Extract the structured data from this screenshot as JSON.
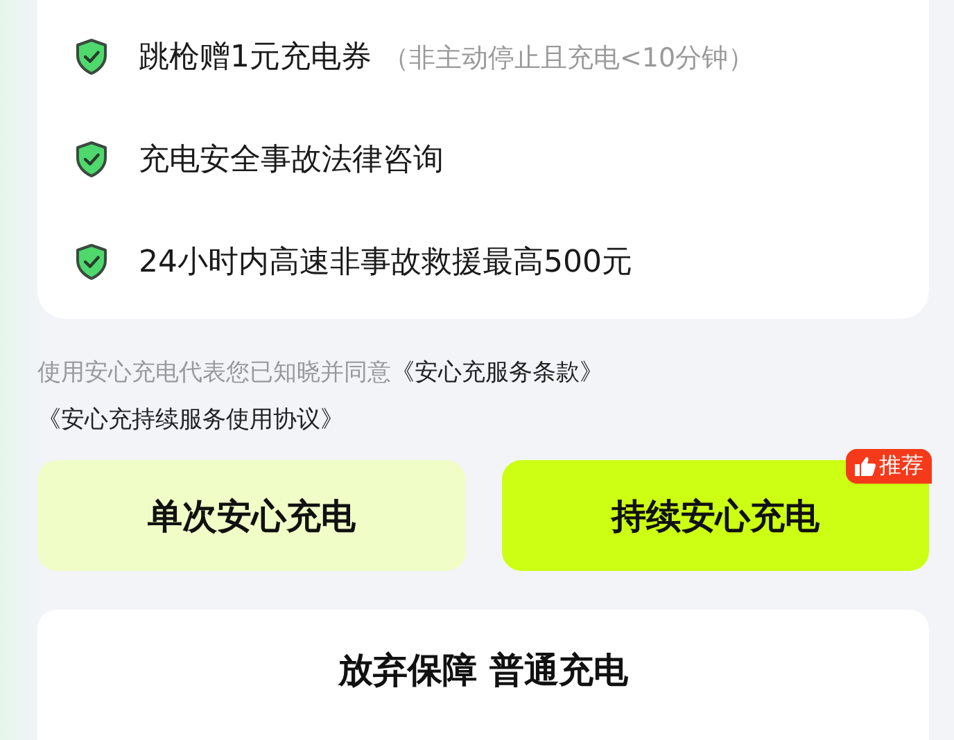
{
  "benefits": [
    {
      "text": "跳枪赠1元充电券",
      "note": "（非主动停止且充电<10分钟）"
    },
    {
      "text": "充电安全事故法律咨询"
    },
    {
      "text": "24小时内高速非事故救援最高500元"
    }
  ],
  "consent": {
    "text": "使用安心充电代表您已知晓并同意",
    "links": [
      "《安心充服务条款》",
      "《安心充持续服务使用协议》"
    ]
  },
  "options": [
    {
      "label": "单次安心充电",
      "kind": "light"
    },
    {
      "label": "持续安心充电",
      "kind": "bright",
      "badge": "推荐"
    }
  ],
  "decline_button": "放弃保障 普通充电"
}
